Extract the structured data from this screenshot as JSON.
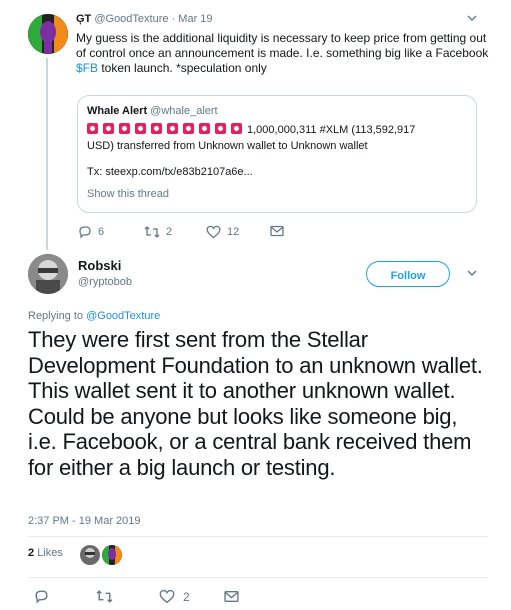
{
  "parent_tweet": {
    "display_name": "ĢΤ",
    "handle": "@GoodTexture",
    "date": "· Mar 19",
    "text_main": "My guess is the additional liquidity is necessary to keep price from getting out of control once an announcement is made. I.e. something big like a Facebook ",
    "cashtag": "$FB",
    "text_after": " token launch. *speculation only",
    "quote": {
      "display_name": "Whale Alert",
      "handle": "@whale_alert",
      "siren_count": 10,
      "text_line1": "1,000,000,311 #XLM (113,592,917",
      "text_line2": "USD) transferred from Unknown wallet to Unknown wallet",
      "tx": "Tx: steexp.com/tx/e83b2107a6e...",
      "show_thread": "Show this thread"
    },
    "replies": "6",
    "retweets": "2",
    "likes": "12"
  },
  "main_tweet": {
    "display_name": "Robski",
    "handle": "@ryptobob",
    "follow_label": "Follow",
    "replying_prefix": "Replying to ",
    "replying_handle": "@GoodTexture",
    "text": "They were first sent from the Stellar Development Foundation to an unknown wallet.  This wallet sent it to another unknown wallet.  Could be anyone but looks like someone big, i.e. Facebook, or a central bank received them for either a big launch or testing.",
    "timestamp": "2:37 PM - 19 Mar 2019",
    "likes_count": "2",
    "likes_label": "Likes",
    "like_count_action": "2"
  },
  "colors": {
    "link": "#1b95e0",
    "follow": "#1da1f2",
    "muted": "#657786",
    "siren": "#e0245e"
  },
  "icons": [
    "reply-icon",
    "retweet-icon",
    "heart-icon",
    "mail-icon",
    "chevron-down-icon"
  ]
}
